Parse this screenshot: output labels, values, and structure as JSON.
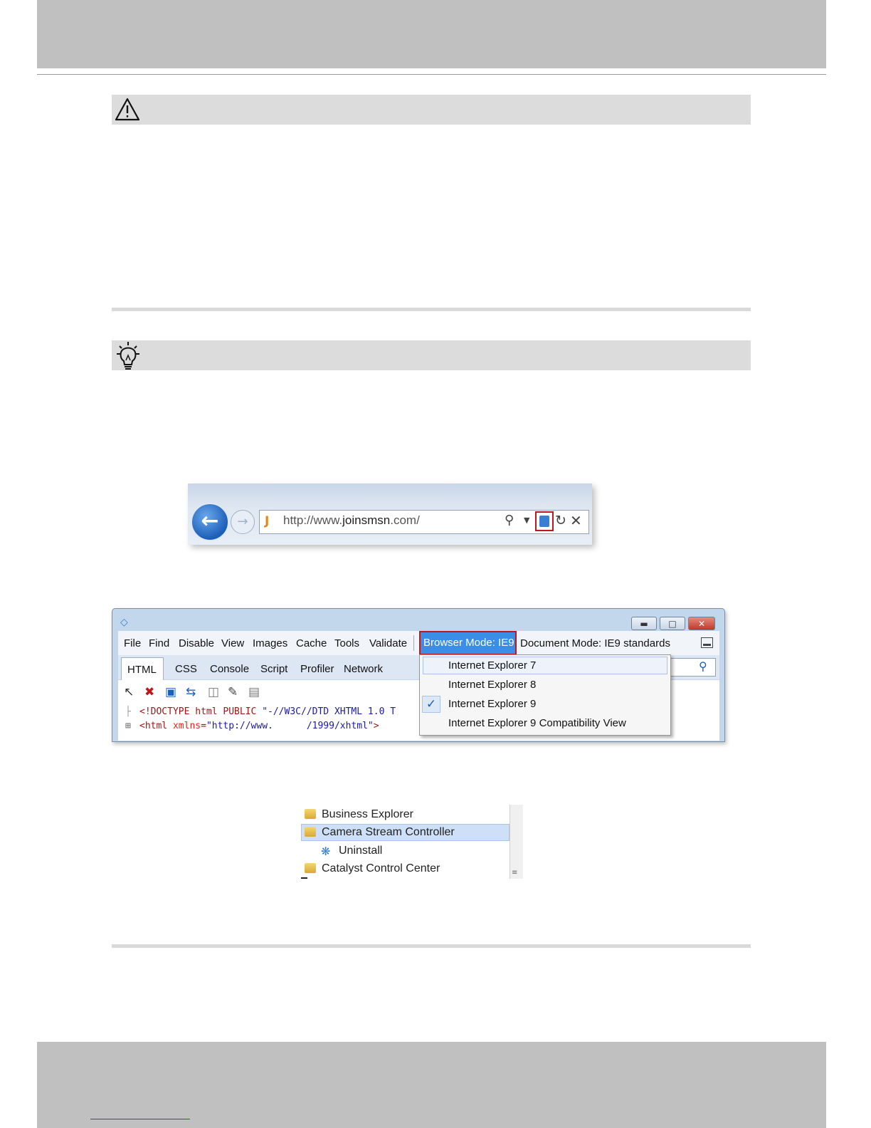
{
  "address_bar": {
    "url_prefix": "http://www.",
    "url_domain": "joinsmsn",
    "url_suffix": ".com/"
  },
  "dev_tools": {
    "menu": [
      "File",
      "Find",
      "Disable",
      "View",
      "Images",
      "Cache",
      "Tools",
      "Validate"
    ],
    "browser_mode": "Browser Mode:  IE9",
    "document_mode": "Document Mode:  IE9 standards",
    "tabs": [
      "HTML",
      "CSS",
      "Console",
      "Script",
      "Profiler",
      "Network"
    ],
    "code_line1_tag": "<!DOCTYPE html PUBLIC",
    "code_line1_str": "\"-//W3C//DTD XHTML 1.0 T",
    "code_line2_tag": "<html",
    "code_line2_attr": "xmlns",
    "code_line2_eq": "=",
    "code_line2_str1": "\"http://www.",
    "code_line2_str2": "/1999/xhtml\"",
    "code_line2_end": ">",
    "browser_mode_options": [
      "Internet Explorer 7",
      "Internet Explorer 8",
      "Internet Explorer 9",
      "Internet Explorer 9 Compatibility View"
    ],
    "selected_option": "Internet Explorer 9"
  },
  "start_menu": {
    "items": [
      "Business Explorer",
      "Camera Stream Controller",
      "Uninstall",
      "Catalyst Control Center"
    ]
  },
  "colors": {
    "highlight_red": "#c0171f",
    "browser_mode_blue": "#3a8ee6"
  }
}
